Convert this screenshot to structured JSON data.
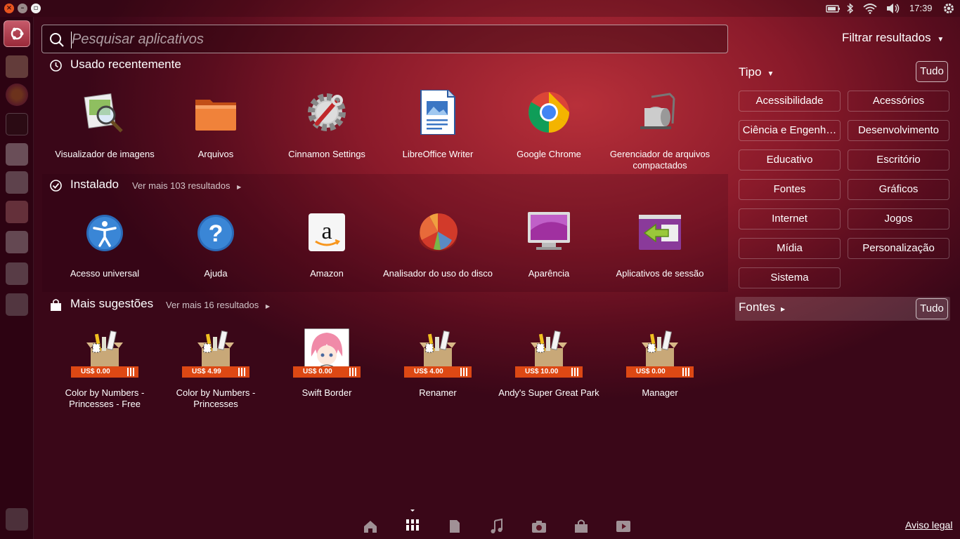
{
  "topbar": {
    "time": "17:39"
  },
  "search": {
    "placeholder": "Pesquisar aplicativos",
    "value": ""
  },
  "filters": {
    "toggle_label": "Filtrar resultados",
    "tipo_label": "Tipo",
    "tipo_all_label": "Tudo",
    "categories": [
      "Acessibilidade",
      "Acessórios",
      "Ciência e Engenh…",
      "Desenvolvimento",
      "Educativo",
      "Escritório",
      "Fontes",
      "Gráficos",
      "Internet",
      "Jogos",
      "Mídia",
      "Personalização",
      "Sistema"
    ],
    "fontes_label": "Fontes",
    "fontes_all_label": "Tudo"
  },
  "sections": {
    "recent": {
      "title": "Usado recentemente",
      "apps": [
        {
          "label": "Visualizador de imagens",
          "icon": "image-viewer-icon"
        },
        {
          "label": "Arquivos",
          "icon": "folder-icon"
        },
        {
          "label": "Cinnamon Settings",
          "icon": "settings-gear-icon"
        },
        {
          "label": "LibreOffice Writer",
          "icon": "writer-document-icon"
        },
        {
          "label": "Google Chrome",
          "icon": "chrome-icon"
        },
        {
          "label": "Gerenciador de arquivos compactados",
          "icon": "archive-manager-icon"
        }
      ]
    },
    "installed": {
      "title": "Instalado",
      "more": "Ver mais 103 resultados",
      "apps": [
        {
          "label": "Acesso universal",
          "icon": "accessibility-icon"
        },
        {
          "label": "Ajuda",
          "icon": "help-icon"
        },
        {
          "label": "Amazon",
          "icon": "amazon-icon"
        },
        {
          "label": "Analisador do uso do disco",
          "icon": "disk-usage-icon"
        },
        {
          "label": "Aparência",
          "icon": "appearance-monitor-icon"
        },
        {
          "label": "Aplicativos de sessão",
          "icon": "session-apps-icon"
        }
      ]
    },
    "suggestions": {
      "title": "Mais sugestões",
      "more": "Ver mais 16 resultados",
      "apps": [
        {
          "label": "Color by Numbers - Princesses - Free",
          "price": "US$ 0.00",
          "icon": "software-box-icon"
        },
        {
          "label": "Color by Numbers - Princesses",
          "price": "US$ 4.99",
          "icon": "software-box-icon"
        },
        {
          "label": "Swift Border",
          "price": "US$ 0.00",
          "icon": "anime-girl-icon"
        },
        {
          "label": "Renamer",
          "price": "US$ 4.00",
          "icon": "software-box-icon"
        },
        {
          "label": "Andy's Super Great Park",
          "price": "US$ 10.00",
          "icon": "software-box-icon"
        },
        {
          "label": "Manager",
          "price": "US$ 0.00",
          "icon": "software-box-icon"
        }
      ]
    }
  },
  "footer": {
    "legal": "Aviso legal"
  },
  "colors": {
    "accent": "#dd4814",
    "background": "#5a0d1e"
  }
}
